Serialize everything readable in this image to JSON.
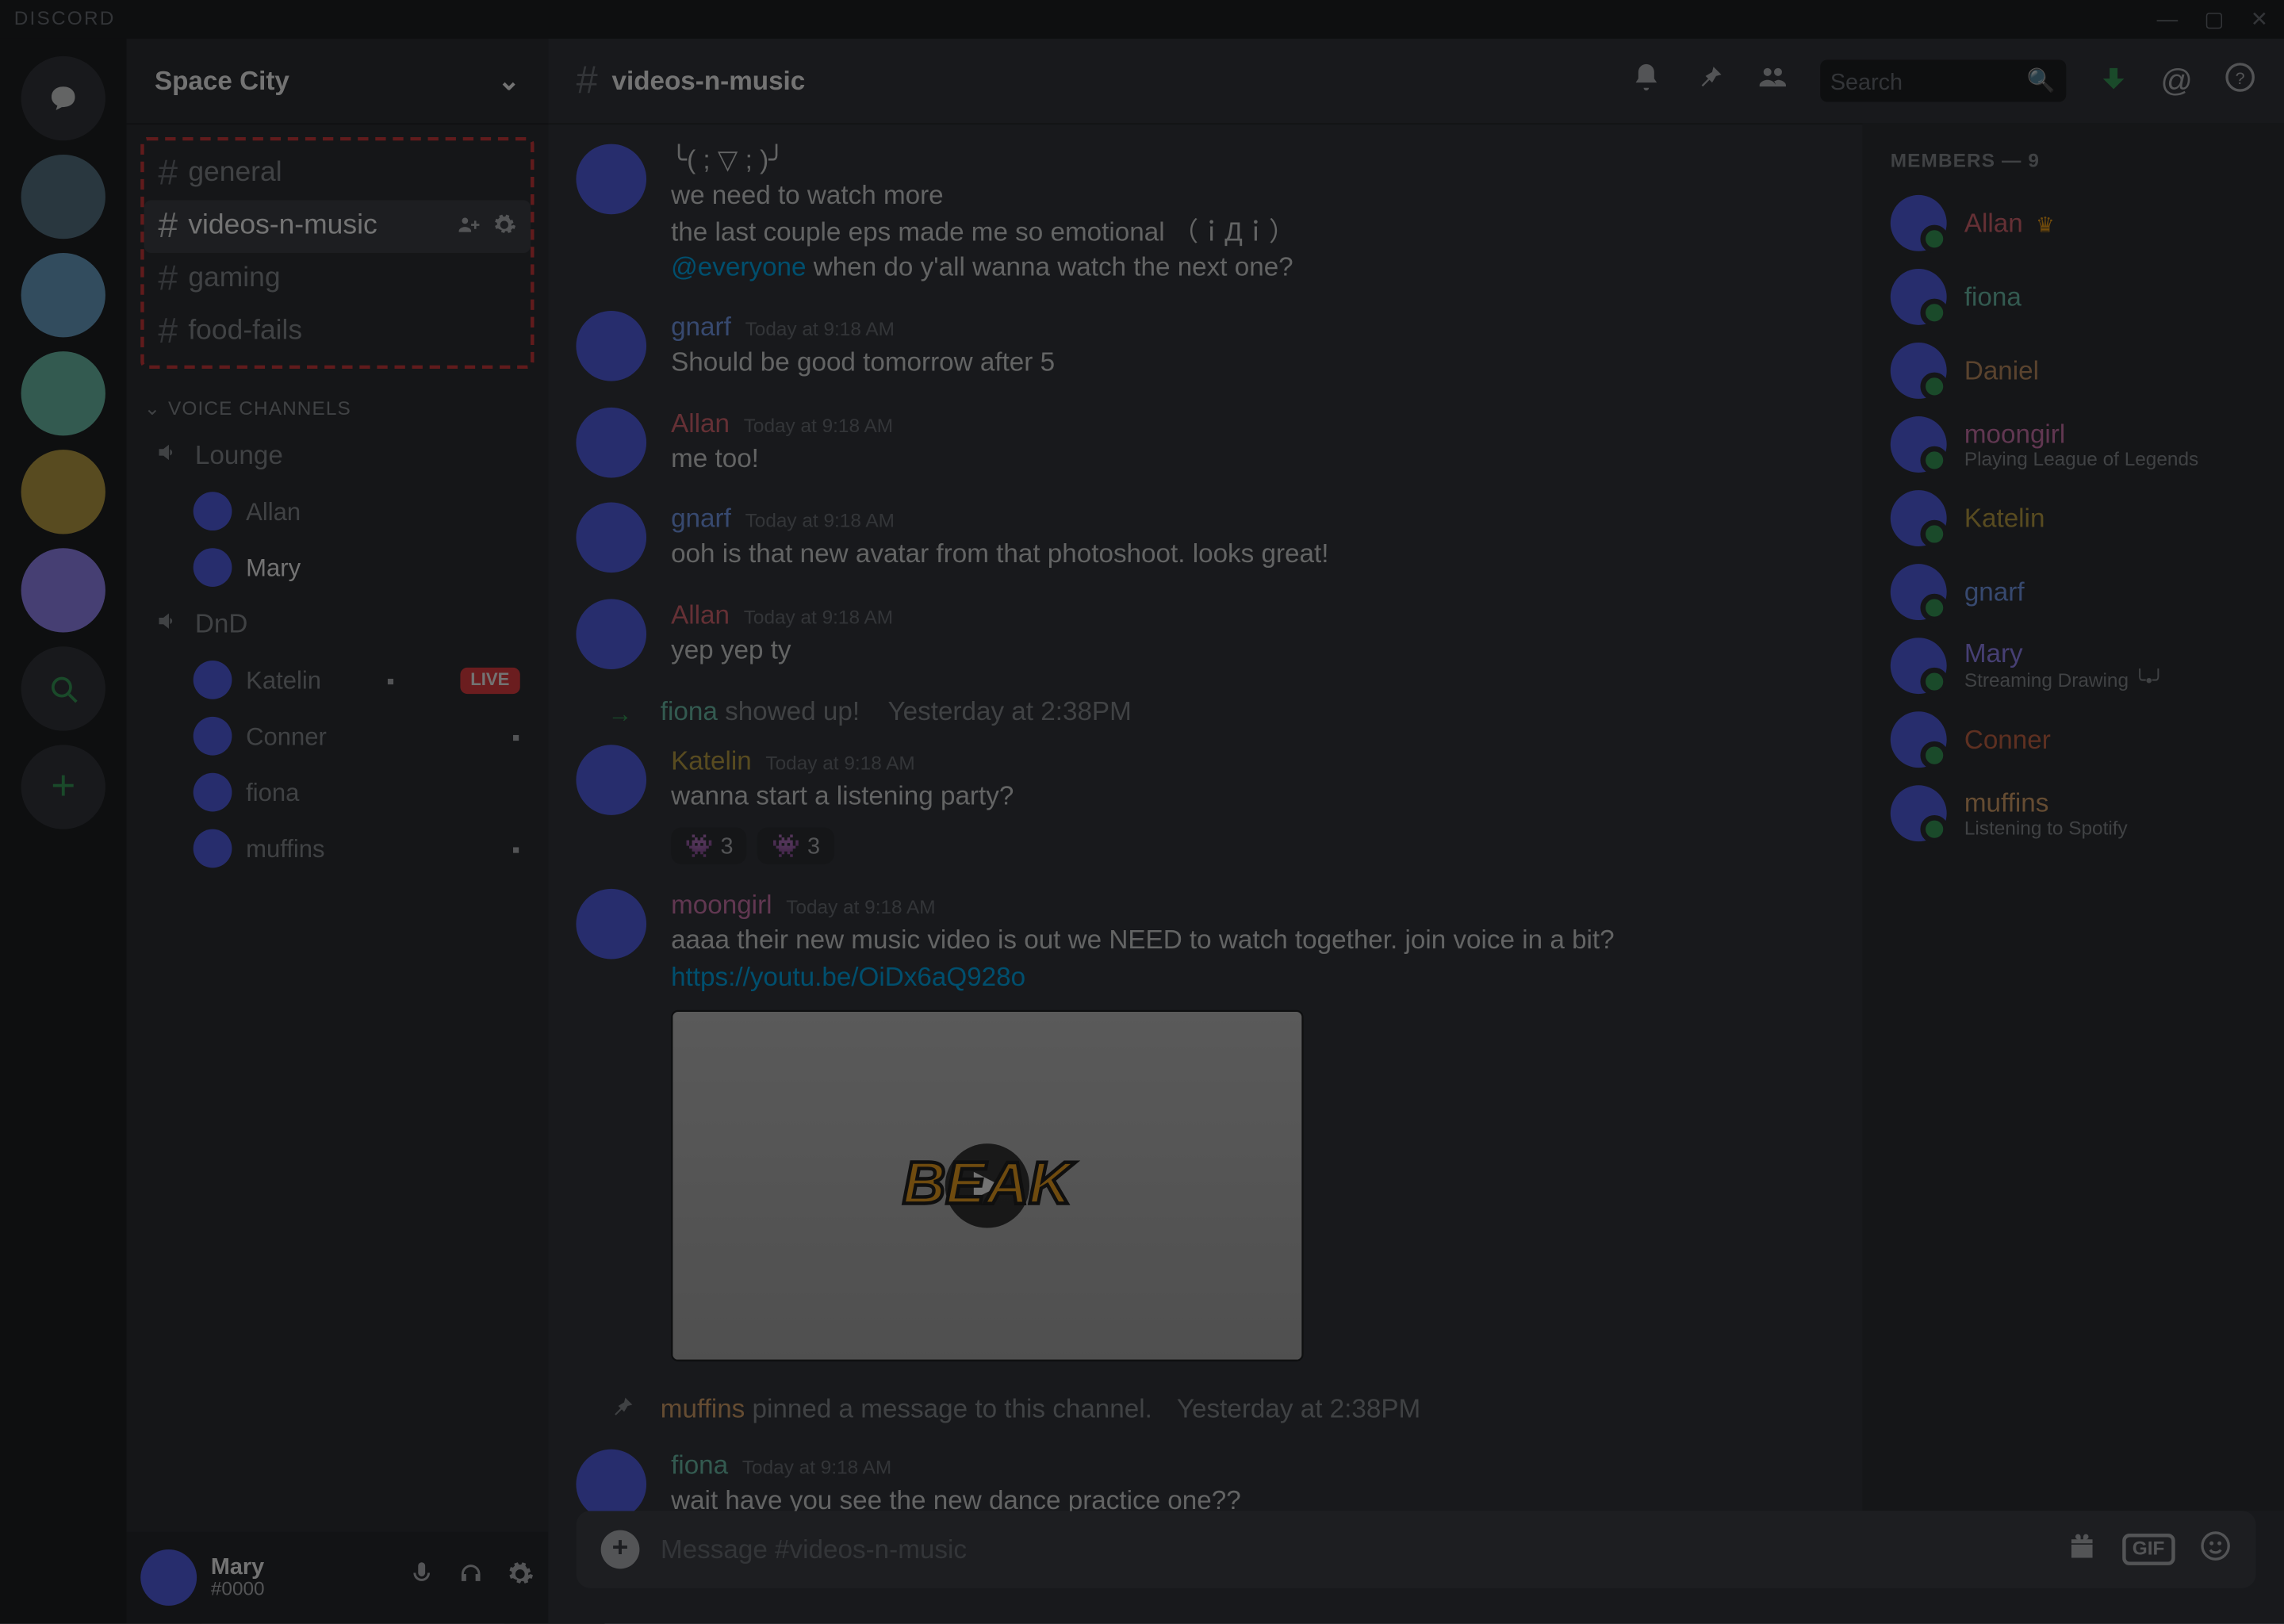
{
  "titlebar": {
    "brand": "DISCORD"
  },
  "server": {
    "name": "Space City",
    "text_channels": [
      {
        "name": "general"
      },
      {
        "name": "videos-n-music",
        "selected": true
      },
      {
        "name": "gaming"
      },
      {
        "name": "food-fails"
      }
    ],
    "voice_category": "VOICE CHANNELS",
    "voice_channels": [
      {
        "name": "Lounge",
        "users": [
          {
            "name": "Allan"
          },
          {
            "name": "Mary",
            "self": true
          }
        ]
      },
      {
        "name": "DnD",
        "users": [
          {
            "name": "Katelin",
            "live": true,
            "streaming": true
          },
          {
            "name": "Conner",
            "streaming": true
          },
          {
            "name": "fiona"
          },
          {
            "name": "muffins",
            "streaming": true
          }
        ]
      }
    ],
    "live_label": "LIVE"
  },
  "self_user": {
    "name": "Mary",
    "tag": "#0000"
  },
  "chat": {
    "channel": "videos-n-music",
    "search_placeholder": "Search",
    "compose_placeholder": "Message #videos-n-music",
    "messages": [
      {
        "kind": "msg",
        "author": "",
        "color": "",
        "avatar": "a1",
        "lines": [
          "╰( ; ▽ ; )╯",
          "we need to watch more",
          "the last couple eps made me so emotional （ｉДｉ）"
        ],
        "mention": "@everyone",
        "tail": " when do y'all wanna watch the next one?"
      },
      {
        "kind": "msg",
        "author": "gnarf",
        "color": "c-gnarf",
        "avatar": "a6",
        "time": "Today at 9:18 AM",
        "lines": [
          "Should be good tomorrow after 5"
        ]
      },
      {
        "kind": "msg",
        "author": "Allan",
        "color": "c-allan",
        "avatar": "a3",
        "time": "Today at 9:18 AM",
        "lines": [
          "me too!"
        ]
      },
      {
        "kind": "msg",
        "author": "gnarf",
        "color": "c-gnarf",
        "avatar": "a6",
        "time": "Today at 9:18 AM",
        "lines": [
          "ooh is that new avatar from that photoshoot. looks great!"
        ]
      },
      {
        "kind": "msg",
        "author": "Allan",
        "color": "c-allan",
        "avatar": "a3",
        "time": "Today at 9:18 AM",
        "lines": [
          "yep yep ty"
        ]
      },
      {
        "kind": "system",
        "text_author": "fiona",
        "text_author_color": "c-fiona",
        "text": " showed up!",
        "time": "Yesterday at 2:38PM"
      },
      {
        "kind": "msg",
        "author": "Katelin",
        "color": "c-katelin",
        "avatar": "a5",
        "time": "Today at 9:18 AM",
        "lines": [
          "wanna start a listening party?"
        ],
        "reactions": [
          {
            "e": "👾",
            "c": "3"
          },
          {
            "e": "👾",
            "c": "3"
          }
        ]
      },
      {
        "kind": "msg",
        "author": "moongirl",
        "color": "c-moongirl",
        "avatar": "a4",
        "time": "Today at 9:18 AM",
        "lines": [
          "aaaa their new music video is out we NEED to watch together. join voice in a bit?"
        ],
        "link": "https://youtu.be/OiDx6aQ928o",
        "embed": true
      },
      {
        "kind": "pin",
        "author": "muffins",
        "color": "c-muffins",
        "text": " pinned a message to this channel.",
        "time": "Yesterday at 2:38PM"
      },
      {
        "kind": "msg",
        "author": "fiona",
        "color": "c-fiona",
        "avatar": "a2",
        "time": "Today at 9:18 AM",
        "lines": [
          "wait have you see the new dance practice one??"
        ]
      }
    ]
  },
  "members": {
    "header": "MEMBERS — 9",
    "list": [
      {
        "name": "Allan",
        "color": "c-allan",
        "avatar": "a1",
        "crown": true
      },
      {
        "name": "fiona",
        "color": "c-fiona",
        "avatar": "a2"
      },
      {
        "name": "Daniel",
        "color": "c-daniel",
        "avatar": "a3"
      },
      {
        "name": "moongirl",
        "color": "c-moongirl",
        "avatar": "a4",
        "status": "Playing League of Legends"
      },
      {
        "name": "Katelin",
        "color": "c-katelin",
        "avatar": "a5"
      },
      {
        "name": "gnarf",
        "color": "c-gnarf",
        "avatar": "a6"
      },
      {
        "name": "Mary",
        "color": "c-mary",
        "avatar": "a7",
        "status": "Streaming Drawing ╰•╯"
      },
      {
        "name": "Conner",
        "color": "c-conner",
        "avatar": "a8"
      },
      {
        "name": "muffins",
        "color": "c-muffins",
        "avatar": "a9",
        "status": "Listening to Spotify"
      }
    ]
  },
  "embed_logo": "BEAK"
}
